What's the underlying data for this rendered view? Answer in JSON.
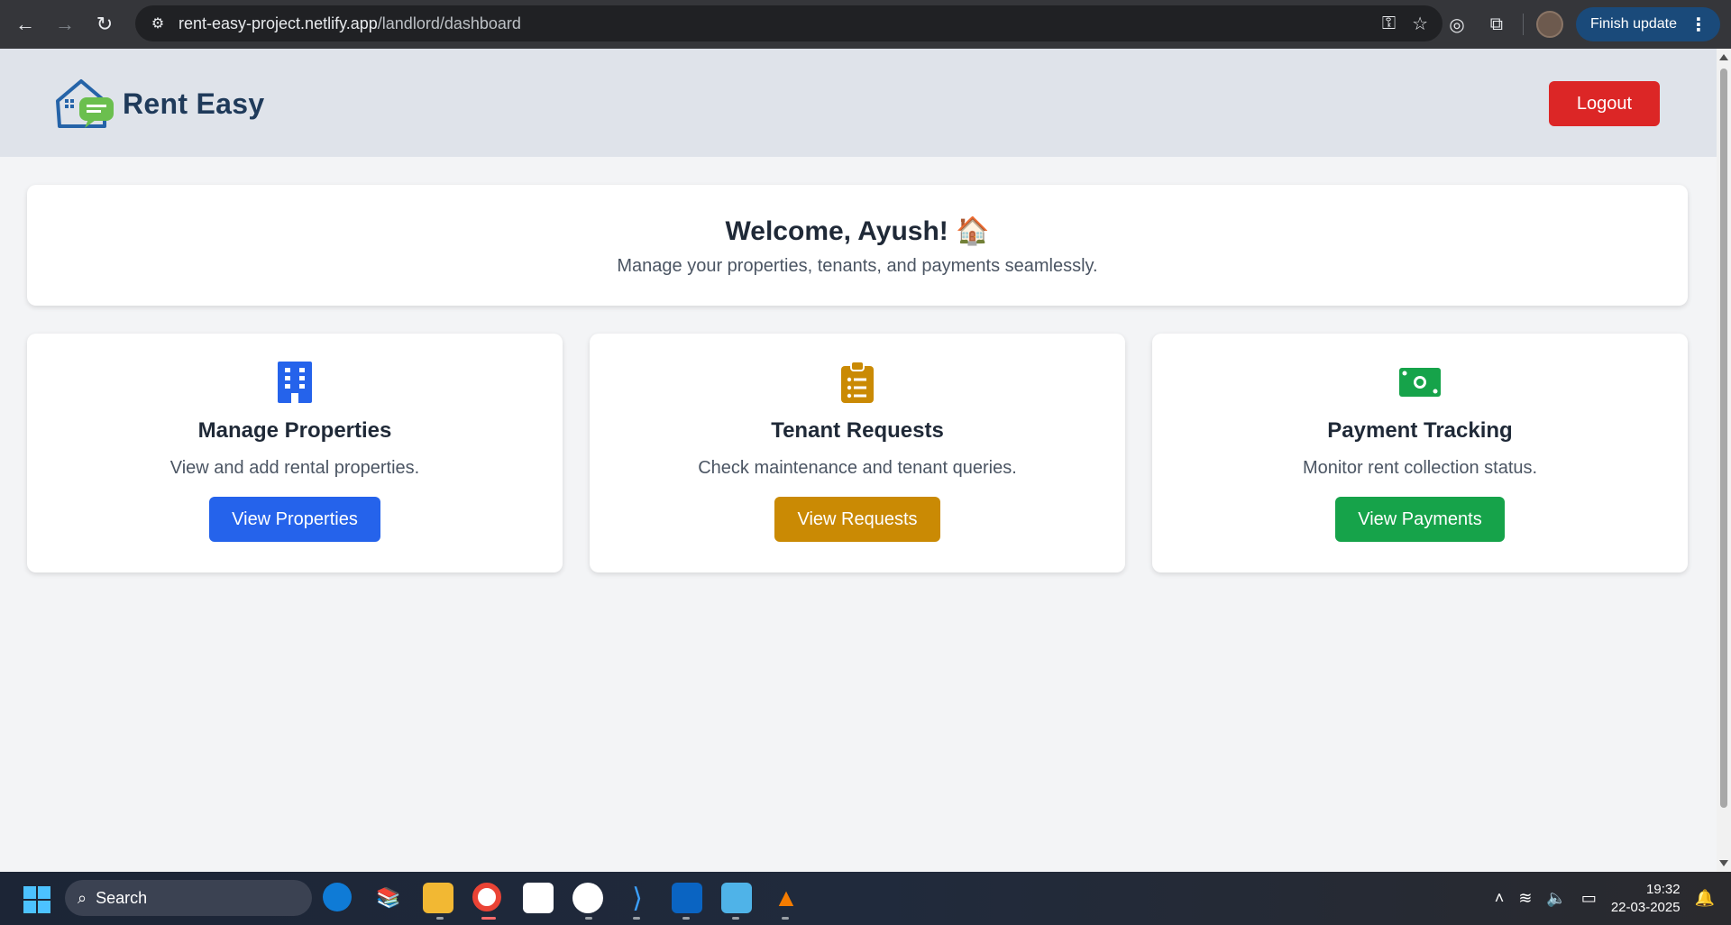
{
  "browser": {
    "url_host": "rent-easy-project.netlify.app",
    "url_path": "/landlord/dashboard",
    "finish_update_label": "Finish update"
  },
  "app": {
    "brand_name": "Rent Easy",
    "logout_label": "Logout"
  },
  "welcome": {
    "title": "Welcome, Ayush! 🏠",
    "subtitle": "Manage your properties, tenants, and payments seamlessly."
  },
  "cards": [
    {
      "icon": "building-icon",
      "title": "Manage Properties",
      "description": "View and add rental properties.",
      "button_label": "View Properties",
      "color": "#2563eb"
    },
    {
      "icon": "clipboard-list-icon",
      "title": "Tenant Requests",
      "description": "Check maintenance and tenant queries.",
      "button_label": "View Requests",
      "color": "#ca8a04"
    },
    {
      "icon": "money-bill-icon",
      "title": "Payment Tracking",
      "description": "Monitor rent collection status.",
      "button_label": "View Payments",
      "color": "#16a34a"
    }
  ],
  "taskbar": {
    "search_label": "Search",
    "time": "19:32",
    "date": "22-03-2025"
  },
  "colors": {
    "accent_blue": "#2563eb",
    "accent_yellow": "#ca8a04",
    "accent_green": "#16a34a",
    "logout_red": "#dc2626"
  }
}
